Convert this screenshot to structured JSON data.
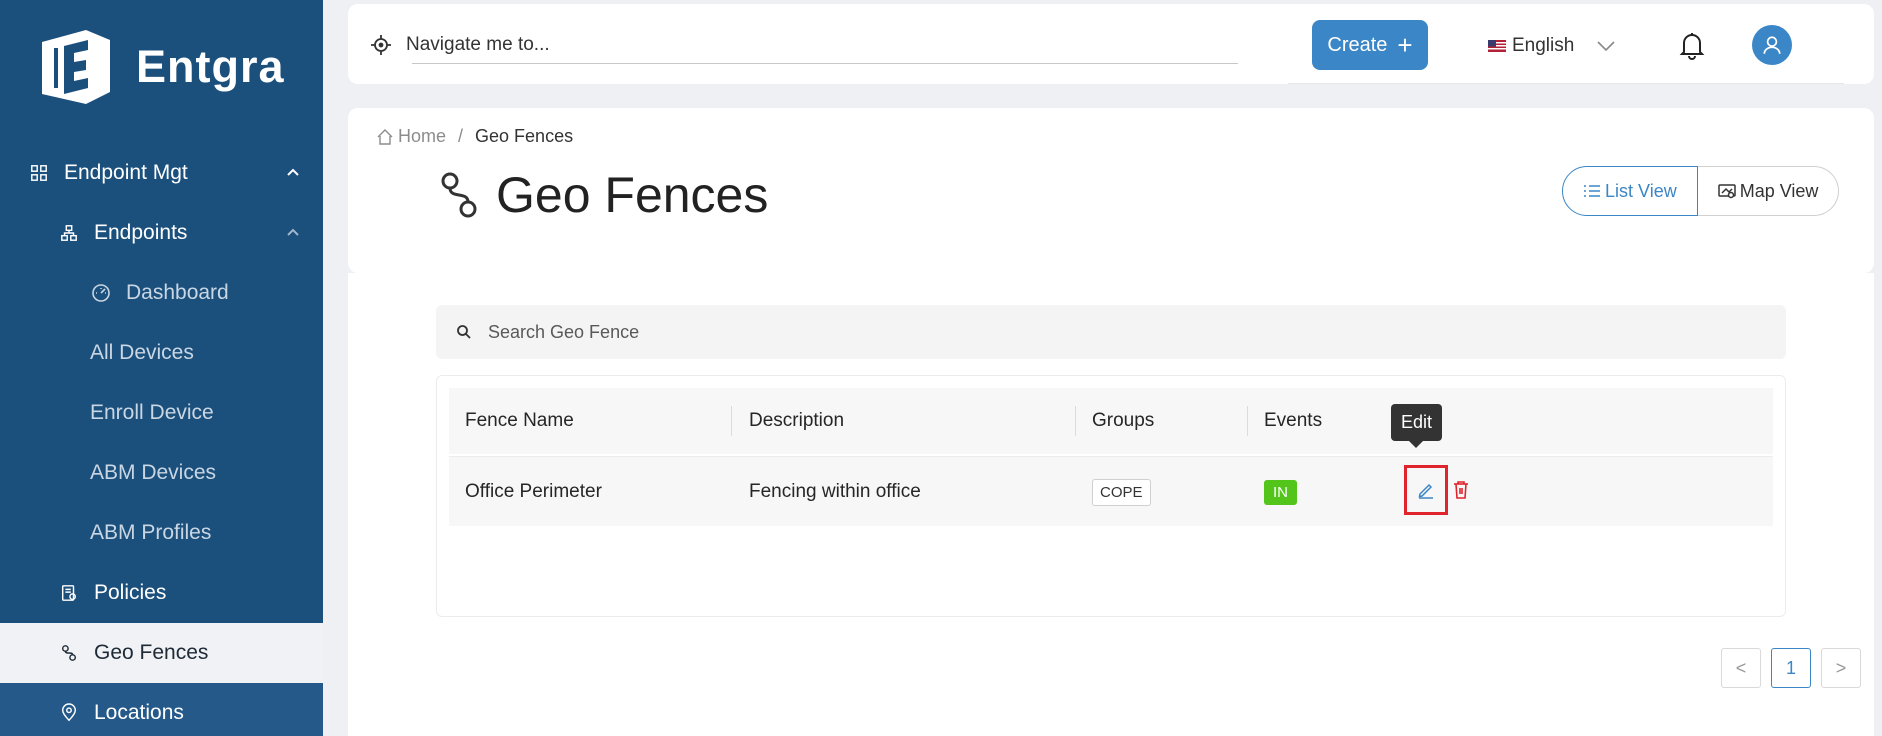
{
  "brand": {
    "name": "Entgra"
  },
  "sidebar": {
    "items": [
      {
        "label": "Endpoint Mgt",
        "icon": "grid-icon"
      },
      {
        "label": "Endpoints",
        "icon": "hierarchy-icon"
      },
      {
        "label": "Dashboard",
        "icon": "gauge-icon"
      },
      {
        "label": "All Devices"
      },
      {
        "label": "Enroll Device"
      },
      {
        "label": "ABM Devices"
      },
      {
        "label": "ABM Profiles"
      },
      {
        "label": "Policies",
        "icon": "policy-icon"
      },
      {
        "label": "Geo Fences",
        "icon": "geofence-icon",
        "active": true
      },
      {
        "label": "Locations",
        "icon": "location-pin-icon"
      }
    ]
  },
  "header": {
    "nav_placeholder": "Navigate me to...",
    "create_label": "Create",
    "language": "English"
  },
  "breadcrumb": {
    "home": "Home",
    "current": "Geo Fences"
  },
  "page": {
    "title": "Geo Fences"
  },
  "views": {
    "list": "List View",
    "map": "Map View"
  },
  "search": {
    "placeholder": "Search Geo Fence"
  },
  "table": {
    "columns": [
      "Fence Name",
      "Description",
      "Groups",
      "Events"
    ],
    "rows": [
      {
        "name": "Office Perimeter",
        "description": "Fencing within office",
        "group": "COPE",
        "event": "IN"
      }
    ]
  },
  "tooltip": {
    "edit": "Edit"
  },
  "pagination": {
    "current": "1",
    "prev": "<",
    "next": ">"
  },
  "colors": {
    "sidebar": "#1b4f7c",
    "accent": "#3b86c6",
    "danger": "#e0242d",
    "success": "#52c41a"
  }
}
